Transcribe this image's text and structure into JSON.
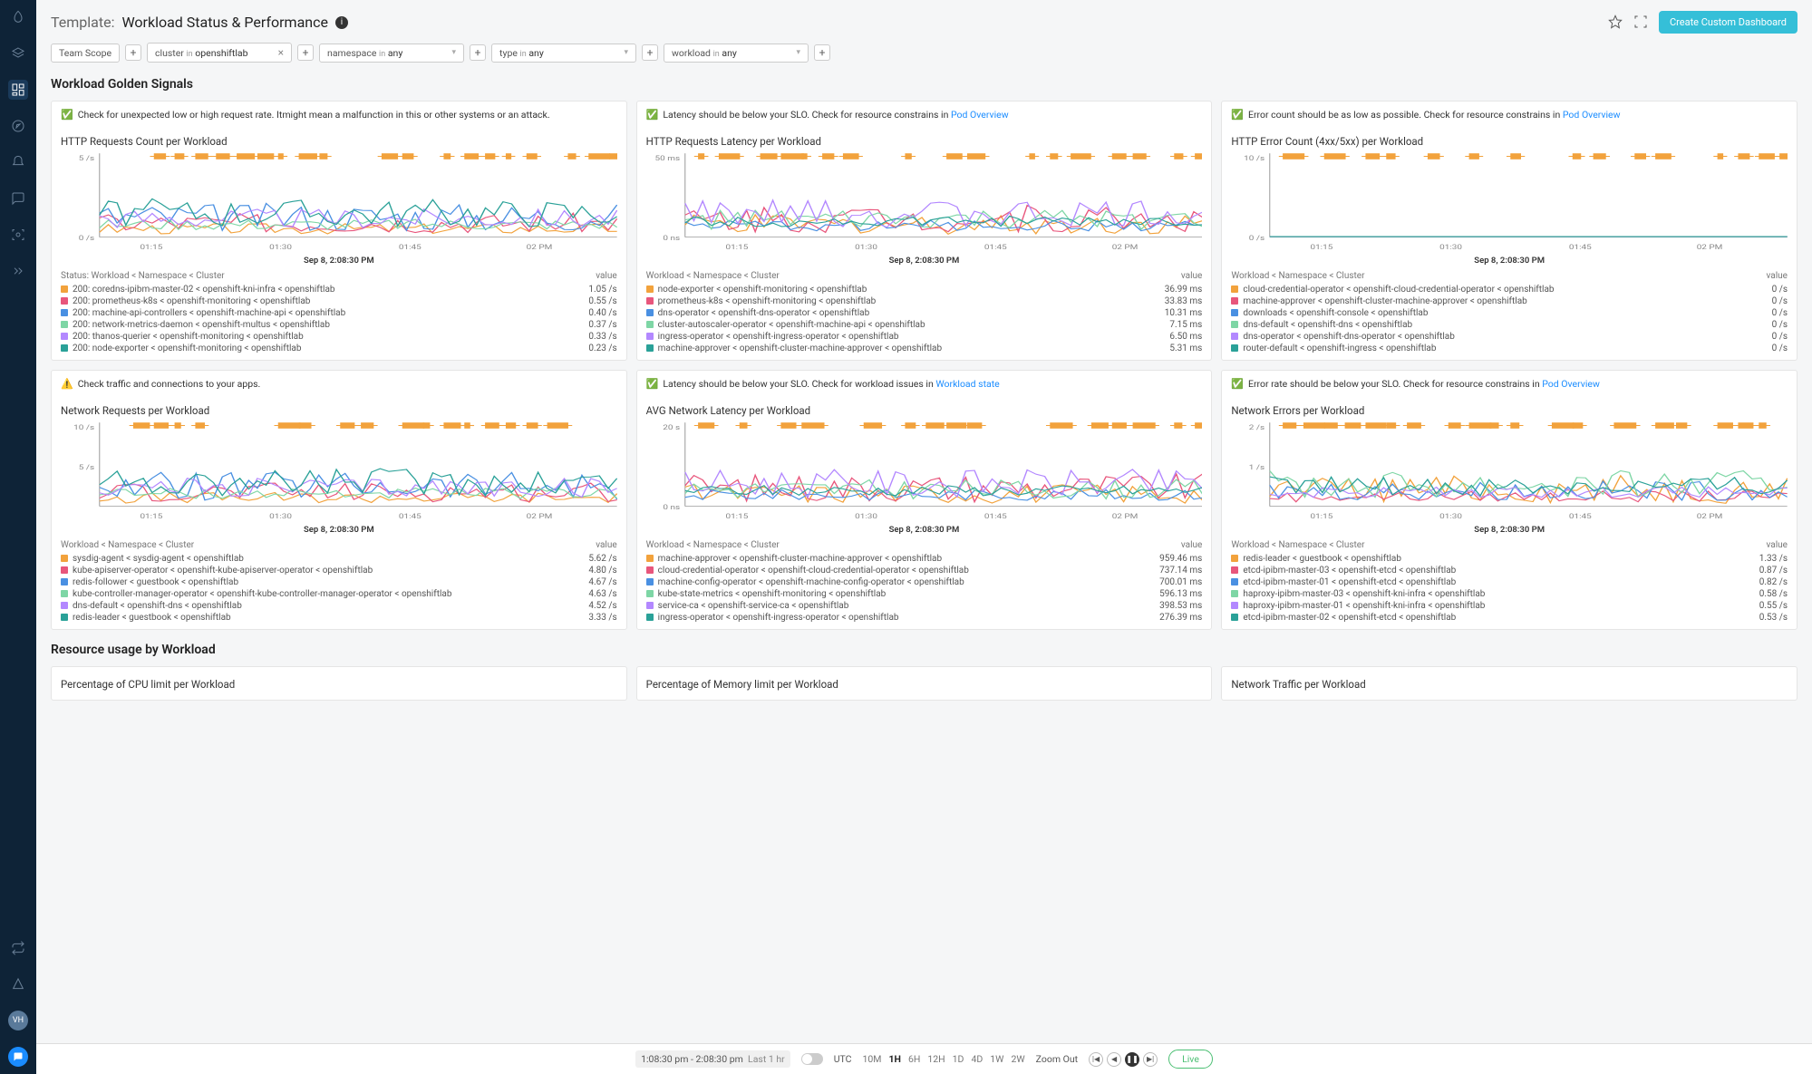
{
  "header": {
    "label": "Template:",
    "name": "Workload Status & Performance",
    "create_btn": "Create Custom Dashboard"
  },
  "filters": {
    "team_scope": "Team Scope",
    "chips": [
      {
        "key": "cluster",
        "op": "in",
        "val": "openshiftlab",
        "closable": true
      },
      {
        "key": "namespace",
        "op": "in",
        "val": "any"
      },
      {
        "key": "type",
        "op": "in",
        "val": "any"
      },
      {
        "key": "workload",
        "op": "in",
        "val": "any"
      }
    ],
    "add": "+"
  },
  "sections": {
    "golden": "Workload Golden Signals",
    "resource": "Resource usage by Workload"
  },
  "timebar": {
    "range": "1:08:30 pm - 2:08:30 pm",
    "last": "Last 1 hr",
    "utc": "UTC",
    "ranges": [
      "10M",
      "1H",
      "6H",
      "12H",
      "1D",
      "4D",
      "1W",
      "2W"
    ],
    "active_range": "1H",
    "zoom_out": "Zoom Out",
    "live": "Live"
  },
  "x_ticks": [
    "01:15",
    "01:30",
    "01:45",
    "02 PM"
  ],
  "chart_timestamp": "Sep 8, 2:08:30 PM",
  "value_label": "value",
  "colors": [
    "#f2a23c",
    "#e8567c",
    "#4a90e2",
    "#7ed6a5",
    "#b388ff",
    "#2aa198",
    "#d97742",
    "#e74c3c",
    "#5cb85c",
    "#b05ce0"
  ],
  "panels": [
    {
      "hint_icon": "✅",
      "hint": "Check for unexpected low or high request rate. Itmight mean a malfunction in this or other systems or an attack.",
      "title": "HTTP Requests Count per Workload",
      "y_ticks": [
        "5 /s",
        "0 /s"
      ],
      "legend_header": "Status: Workload < Namespace < Cluster",
      "legend": [
        {
          "c": "#f2a23c",
          "name": "200: coredns-ipibm-master-02 < openshift-kni-infra < openshiftlab",
          "val": "1.05 /s"
        },
        {
          "c": "#e8567c",
          "name": "200: prometheus-k8s < openshift-monitoring < openshiftlab",
          "val": "0.55 /s"
        },
        {
          "c": "#4a90e2",
          "name": "200: machine-api-controllers < openshift-machine-api < openshiftlab",
          "val": "0.40 /s"
        },
        {
          "c": "#7ed6a5",
          "name": "200: network-metrics-daemon < openshift-multus < openshiftlab",
          "val": "0.37 /s"
        },
        {
          "c": "#b388ff",
          "name": "200: thanos-querier < openshift-monitoring < openshiftlab",
          "val": "0.33 /s"
        },
        {
          "c": "#2aa198",
          "name": "200: node-exporter < openshift-monitoring < openshiftlab",
          "val": "0.23 /s"
        }
      ]
    },
    {
      "hint_icon": "✅",
      "hint": "Latency should be below your SLO. Check for resource constrains in ",
      "hint_link": "Pod Overview",
      "title": "HTTP Requests Latency per Workload",
      "y_ticks": [
        "50 ms",
        "0 ns"
      ],
      "legend_header": "Workload < Namespace < Cluster",
      "legend": [
        {
          "c": "#f2a23c",
          "name": "node-exporter < openshift-monitoring < openshiftlab",
          "val": "36.99 ms"
        },
        {
          "c": "#e8567c",
          "name": "prometheus-k8s < openshift-monitoring < openshiftlab",
          "val": "33.83 ms"
        },
        {
          "c": "#4a90e2",
          "name": "dns-operator < openshift-dns-operator < openshiftlab",
          "val": "10.31 ms"
        },
        {
          "c": "#7ed6a5",
          "name": "cluster-autoscaler-operator < openshift-machine-api < openshiftlab",
          "val": "7.15 ms"
        },
        {
          "c": "#b388ff",
          "name": "ingress-operator < openshift-ingress-operator < openshiftlab",
          "val": "6.50 ms"
        },
        {
          "c": "#2aa198",
          "name": "machine-approver < openshift-cluster-machine-approver < openshiftlab",
          "val": "5.31 ms"
        }
      ]
    },
    {
      "hint_icon": "✅",
      "hint": "Error count should be as low as possible. Check for resource constrains in ",
      "hint_link": "Pod Overview",
      "title": "HTTP Error Count (4xx/5xx) per Workload",
      "y_ticks": [
        "10 /s",
        "0 /s"
      ],
      "flat_zero": true,
      "legend_header": "Workload < Namespace < Cluster",
      "legend": [
        {
          "c": "#f2a23c",
          "name": "cloud-credential-operator < openshift-cloud-credential-operator < openshiftlab",
          "val": "0 /s"
        },
        {
          "c": "#e8567c",
          "name": "machine-approver < openshift-cluster-machine-approver < openshiftlab",
          "val": "0 /s"
        },
        {
          "c": "#4a90e2",
          "name": "downloads < openshift-console < openshiftlab",
          "val": "0 /s"
        },
        {
          "c": "#7ed6a5",
          "name": "dns-default < openshift-dns < openshiftlab",
          "val": "0 /s"
        },
        {
          "c": "#b388ff",
          "name": "dns-operator < openshift-dns-operator < openshiftlab",
          "val": "0 /s"
        },
        {
          "c": "#2aa198",
          "name": "router-default < openshift-ingress < openshiftlab",
          "val": "0 /s"
        }
      ]
    },
    {
      "hint_icon": "⚠️",
      "hint": "Check traffic and connections to your apps.",
      "title": "Network Requests per Workload",
      "y_ticks": [
        "10 /s",
        "5 /s",
        ""
      ],
      "legend_header": "Workload < Namespace < Cluster",
      "legend": [
        {
          "c": "#f2a23c",
          "name": "sysdig-agent < sysdig-agent < openshiftlab",
          "val": "5.62 /s"
        },
        {
          "c": "#e8567c",
          "name": "kube-apiserver-operator < openshift-kube-apiserver-operator < openshiftlab",
          "val": "4.80 /s"
        },
        {
          "c": "#4a90e2",
          "name": "redis-follower < guestbook < openshiftlab",
          "val": "4.67 /s"
        },
        {
          "c": "#7ed6a5",
          "name": "kube-controller-manager-operator < openshift-kube-controller-manager-operator < openshiftlab",
          "val": "4.63 /s"
        },
        {
          "c": "#b388ff",
          "name": "dns-default < openshift-dns < openshiftlab",
          "val": "4.52 /s"
        },
        {
          "c": "#2aa198",
          "name": "redis-leader < guestbook < openshiftlab",
          "val": "3.33 /s"
        }
      ]
    },
    {
      "hint_icon": "✅",
      "hint": "Latency should be below your SLO. Check for workload issues in ",
      "hint_link": "Workload state",
      "title": "AVG Network Latency per Workload",
      "y_ticks": [
        "20 s",
        "0 ns"
      ],
      "legend_header": "Workload < Namespace < Cluster",
      "legend": [
        {
          "c": "#f2a23c",
          "name": "machine-approver < openshift-cluster-machine-approver < openshiftlab",
          "val": "959.46 ms"
        },
        {
          "c": "#e8567c",
          "name": "cloud-credential-operator < openshift-cloud-credential-operator < openshiftlab",
          "val": "737.14 ms"
        },
        {
          "c": "#4a90e2",
          "name": "machine-config-operator < openshift-machine-config-operator < openshiftlab",
          "val": "700.01 ms"
        },
        {
          "c": "#7ed6a5",
          "name": "kube-state-metrics < openshift-monitoring < openshiftlab",
          "val": "596.13 ms"
        },
        {
          "c": "#b388ff",
          "name": "service-ca < openshift-service-ca < openshiftlab",
          "val": "398.53 ms"
        },
        {
          "c": "#2aa198",
          "name": "ingress-operator < openshift-ingress-operator < openshiftlab",
          "val": "276.39 ms"
        }
      ]
    },
    {
      "hint_icon": "✅",
      "hint": "Error rate should be below your SLO. Check for resource constrains in ",
      "hint_link": "Pod Overview",
      "title": "Network Errors per Workload",
      "y_ticks": [
        "2 /s",
        "1 /s",
        ""
      ],
      "legend_header": "Workload < Namespace < Cluster",
      "legend": [
        {
          "c": "#f2a23c",
          "name": "redis-leader < guestbook < openshiftlab",
          "val": "1.33 /s"
        },
        {
          "c": "#e8567c",
          "name": "etcd-ipibm-master-03 < openshift-etcd < openshiftlab",
          "val": "0.87 /s"
        },
        {
          "c": "#4a90e2",
          "name": "etcd-ipibm-master-01 < openshift-etcd < openshiftlab",
          "val": "0.82 /s"
        },
        {
          "c": "#7ed6a5",
          "name": "haproxy-ipibm-master-03 < openshift-kni-infra < openshiftlab",
          "val": "0.58 /s"
        },
        {
          "c": "#b388ff",
          "name": "haproxy-ipibm-master-01 < openshift-kni-infra < openshiftlab",
          "val": "0.55 /s"
        },
        {
          "c": "#2aa198",
          "name": "etcd-ipibm-master-02 < openshift-etcd < openshiftlab",
          "val": "0.53 /s"
        }
      ]
    }
  ],
  "resource_panels": [
    {
      "title": "Percentage of CPU limit per Workload"
    },
    {
      "title": "Percentage of Memory limit per Workload"
    },
    {
      "title": "Network Traffic per Workload"
    }
  ],
  "chart_data": [
    {
      "type": "line",
      "title": "HTTP Requests Count per Workload",
      "ylabel": "/s",
      "ylim": [
        0,
        7
      ],
      "x": [
        "01:15",
        "01:30",
        "01:45",
        "02 PM"
      ],
      "series": [
        {
          "name": "coredns-ipibm-master-02",
          "values": [
            1.05
          ]
        },
        {
          "name": "prometheus-k8s",
          "values": [
            0.55
          ]
        },
        {
          "name": "machine-api-controllers",
          "values": [
            0.4
          ]
        },
        {
          "name": "network-metrics-daemon",
          "values": [
            0.37
          ]
        },
        {
          "name": "thanos-querier",
          "values": [
            0.33
          ]
        },
        {
          "name": "node-exporter",
          "values": [
            0.23
          ]
        }
      ]
    },
    {
      "type": "line",
      "title": "HTTP Requests Latency per Workload",
      "ylabel": "ms",
      "ylim": [
        0,
        50
      ],
      "x": [
        "01:15",
        "01:30",
        "01:45",
        "02 PM"
      ],
      "series": [
        {
          "name": "node-exporter",
          "values": [
            36.99
          ]
        },
        {
          "name": "prometheus-k8s",
          "values": [
            33.83
          ]
        },
        {
          "name": "dns-operator",
          "values": [
            10.31
          ]
        },
        {
          "name": "cluster-autoscaler-operator",
          "values": [
            7.15
          ]
        },
        {
          "name": "ingress-operator",
          "values": [
            6.5
          ]
        },
        {
          "name": "machine-approver",
          "values": [
            5.31
          ]
        }
      ]
    },
    {
      "type": "line",
      "title": "HTTP Error Count (4xx/5xx) per Workload",
      "ylabel": "/s",
      "ylim": [
        0,
        10
      ],
      "x": [
        "01:15",
        "01:30",
        "01:45",
        "02 PM"
      ],
      "series": [
        {
          "name": "cloud-credential-operator",
          "values": [
            0
          ]
        },
        {
          "name": "machine-approver",
          "values": [
            0
          ]
        },
        {
          "name": "downloads",
          "values": [
            0
          ]
        },
        {
          "name": "dns-default",
          "values": [
            0
          ]
        },
        {
          "name": "dns-operator",
          "values": [
            0
          ]
        },
        {
          "name": "router-default",
          "values": [
            0
          ]
        }
      ]
    },
    {
      "type": "line",
      "title": "Network Requests per Workload",
      "ylabel": "/s",
      "ylim": [
        0,
        12
      ],
      "x": [
        "01:15",
        "01:30",
        "01:45",
        "02 PM"
      ],
      "series": [
        {
          "name": "sysdig-agent",
          "values": [
            5.62
          ]
        },
        {
          "name": "kube-apiserver-operator",
          "values": [
            4.8
          ]
        },
        {
          "name": "redis-follower",
          "values": [
            4.67
          ]
        },
        {
          "name": "kube-controller-manager-operator",
          "values": [
            4.63
          ]
        },
        {
          "name": "dns-default",
          "values": [
            4.52
          ]
        },
        {
          "name": "redis-leader",
          "values": [
            3.33
          ]
        }
      ]
    },
    {
      "type": "line",
      "title": "AVG Network Latency per Workload",
      "ylabel": "ms",
      "ylim": [
        0,
        20000
      ],
      "x": [
        "01:15",
        "01:30",
        "01:45",
        "02 PM"
      ],
      "series": [
        {
          "name": "machine-approver",
          "values": [
            959.46
          ]
        },
        {
          "name": "cloud-credential-operator",
          "values": [
            737.14
          ]
        },
        {
          "name": "machine-config-operator",
          "values": [
            700.01
          ]
        },
        {
          "name": "kube-state-metrics",
          "values": [
            596.13
          ]
        },
        {
          "name": "service-ca",
          "values": [
            398.53
          ]
        },
        {
          "name": "ingress-operator",
          "values": [
            276.39
          ]
        }
      ]
    },
    {
      "type": "line",
      "title": "Network Errors per Workload",
      "ylabel": "/s",
      "ylim": [
        0,
        2
      ],
      "x": [
        "01:15",
        "01:30",
        "01:45",
        "02 PM"
      ],
      "series": [
        {
          "name": "redis-leader",
          "values": [
            1.33
          ]
        },
        {
          "name": "etcd-ipibm-master-03",
          "values": [
            0.87
          ]
        },
        {
          "name": "etcd-ipibm-master-01",
          "values": [
            0.82
          ]
        },
        {
          "name": "haproxy-ipibm-master-03",
          "values": [
            0.58
          ]
        },
        {
          "name": "haproxy-ipibm-master-01",
          "values": [
            0.55
          ]
        },
        {
          "name": "etcd-ipibm-master-02",
          "values": [
            0.53
          ]
        }
      ]
    }
  ]
}
